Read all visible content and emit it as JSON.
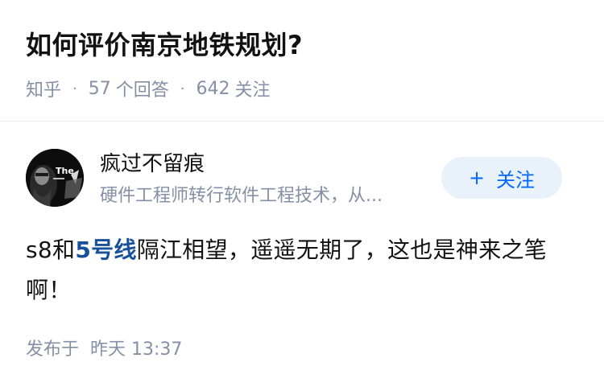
{
  "question": {
    "title": "如何评价南京地铁规划?",
    "source": "知乎",
    "answer_count": "57",
    "answer_label": "个回答",
    "follower_count": "642",
    "follower_label": "关注"
  },
  "author": {
    "name": "疯过不留痕",
    "bio": "硬件工程师转行软件工程技术，从...",
    "follow_label": "关注",
    "follow_icon": "plus-icon",
    "avatar_text": "The"
  },
  "answer": {
    "text_before": "s8和",
    "link_text": "5号线",
    "text_after": "隔江相望，遥遥无期了，这也是神来之笔啊！",
    "published_label": "发布于",
    "published_time": "昨天 13:37"
  },
  "colors": {
    "accent": "#0066ff",
    "link": "#175199",
    "muted": "#8590a6",
    "text": "#121212"
  }
}
